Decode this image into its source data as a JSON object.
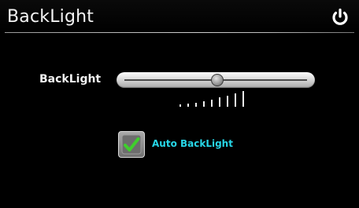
{
  "window": {
    "title": "BackLight",
    "power_icon": "power-icon"
  },
  "backlight_control": {
    "label": "BackLight",
    "level_fraction": 0.51,
    "level_bars_count": 9,
    "level_bars_lit": 9
  },
  "auto_backlight": {
    "label": "Auto BackLight",
    "checked": true,
    "check_icon": "checkmark-icon",
    "label_color": "#27d7e8",
    "check_color": "#3fcf2c"
  }
}
